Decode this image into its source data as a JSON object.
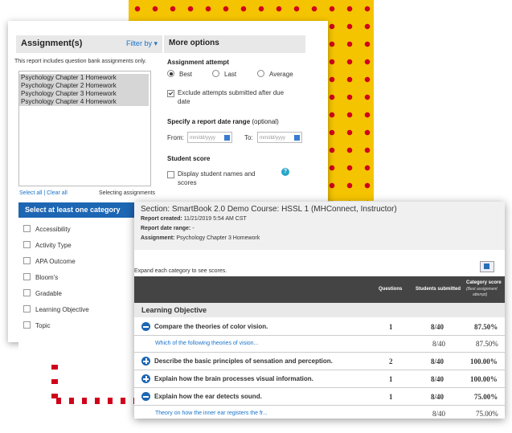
{
  "left_panel": {
    "assignments_title": "Assignment(s)",
    "filter_label": "Filter by",
    "note": "This report includes question bank assignments only.",
    "assignments": [
      "Psychology Chapter 1 Homework",
      "Psychology Chapter 2 Homework",
      "Psychology Chapter 3 Homework",
      "Psychology Chapter 4 Homework"
    ],
    "select_links": "Select all | Clear all",
    "selecting_note": "Selecting assignments",
    "category_header": "Select at least one category",
    "categories": [
      "Accessibility",
      "Activity Type",
      "APA Outcome",
      "Bloom's",
      "Gradable",
      "Learning Objective",
      "Topic"
    ]
  },
  "more_options": {
    "title": "More options",
    "attempt_label": "Assignment attempt",
    "radios": [
      "Best",
      "Last",
      "Average"
    ],
    "selected_radio": "Best",
    "exclude_label_1": "Exclude attempts submitted after due",
    "exclude_label_2": "date",
    "date_range_label": "Specify a report date range",
    "date_range_optional": "(optional)",
    "from_label": "From:",
    "to_label": "To:",
    "date_placeholder": "mm/dd/yyyy",
    "student_score_label": "Student score",
    "display_names_1": "Display student names and",
    "display_names_2": "scores",
    "help_glyph": "?"
  },
  "report": {
    "section_title": "Section: SmartBook 2.0 Demo Course: HSSL 1 (MHConnect, Instructor)",
    "created_label": "Report created:",
    "created_value": "11/21/2019 5:54 AM CST",
    "range_label": "Report date range:",
    "range_value": "-",
    "assignment_label": "Assignment:",
    "assignment_value": "Psychology Chapter 3 Homework",
    "expand_note": "Expand each category to see scores.",
    "col_questions": "Questions",
    "col_students": "Students submitted",
    "col_score": "Category score",
    "col_score_sub_1": "(Best assignment",
    "col_score_sub_2": "attempt)",
    "category": "Learning Objective",
    "rows": [
      {
        "title": "Compare the theories of color vision.",
        "questions": "1",
        "students": "8/40",
        "score": "87.50%",
        "expanded": true
      },
      {
        "sub": "Which of the following theories of vision...",
        "students": "8/40",
        "score": "87.50%"
      },
      {
        "title": "Describe the basic principles of sensation and perception.",
        "questions": "2",
        "students": "8/40",
        "score": "100.00%",
        "expanded": false
      },
      {
        "title": "Explain how the brain processes visual information.",
        "questions": "1",
        "students": "8/40",
        "score": "100.00%",
        "expanded": false
      },
      {
        "title": "Explain how the ear detects sound.",
        "questions": "1",
        "students": "8/40",
        "score": "75.00%",
        "expanded": true
      },
      {
        "sub": "Theory on how the inner ear registers the fr...",
        "students": "8/40",
        "score": "75.00%"
      }
    ]
  },
  "colors": {
    "accent_blue": "#1d66b3",
    "link_blue": "#1a73c9",
    "yellow": "#f5c400",
    "dot_red": "#d0021b"
  }
}
